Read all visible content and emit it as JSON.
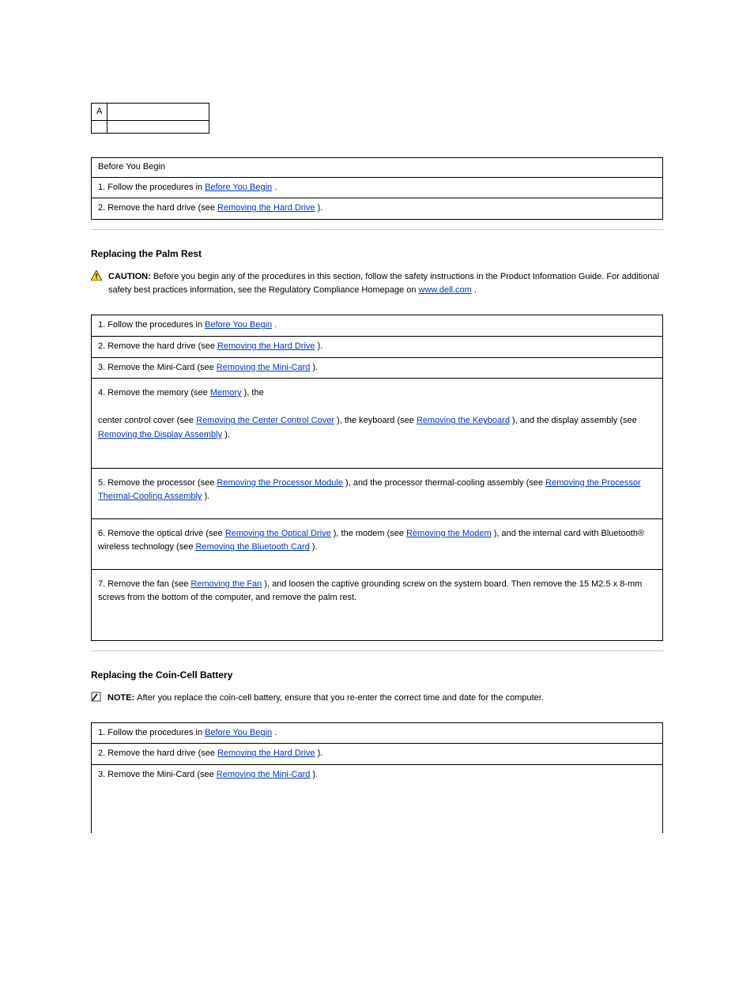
{
  "typeA": {
    "rows": [
      [
        "A",
        ""
      ],
      [
        "",
        ""
      ]
    ]
  },
  "before": {
    "header": "Before You Begin",
    "row1": {
      "prefix": "1. Follow the procedures in ",
      "link": "Before You Begin",
      "suffix": "."
    },
    "row2": {
      "prefix": "2. Remove the hard drive (see ",
      "link": "Removing the Hard Drive",
      "suffix": ")."
    }
  },
  "palm": {
    "heading": "Replacing the Palm Rest",
    "caution": {
      "bold": "CAUTION: ",
      "body": "Before you begin any of the procedures in this section, follow the safety instructions in the Product Information Guide. For additional safety best practices information, see the Regulatory Compliance Homepage on ",
      "linkText": "www.dell.com",
      "suffix": "."
    },
    "rows": {
      "r1": {
        "prefix": "1. Follow the procedures in ",
        "link": "Before You Begin",
        "suffix": "."
      },
      "r2": {
        "prefix": "2. Remove the hard drive (see ",
        "link": "Removing the Hard Drive",
        "suffix": ")."
      },
      "r3": {
        "prefix": "3. Remove the Mini-Card (see ",
        "link": "Removing the Mini-Card",
        "suffix": ")."
      },
      "r4": {
        "prefix": "4. Remove the memory (see ",
        "link1": "Memory",
        "mid": "), the ",
        "body2": "center control cover (see ",
        "link2": "Removing the Center Control Cover",
        "body3": "), the keyboard (see ",
        "link3": "Removing the Keyboard",
        "body4": "), and the display assembly (see ",
        "link4": "Removing the Display Assembly",
        "suffix": ")."
      },
      "r5": {
        "prefix": "5. Remove the processor (see ",
        "link1": "Removing the Processor Module",
        "body2": "), and the processor thermal-cooling assembly (see ",
        "link2": "Removing the Processor Thermal-Cooling Assembly",
        "suffix": ")."
      },
      "r6": {
        "prefix": "6. Remove the optical drive (see ",
        "link1": "Removing the Optical Drive",
        "body2": "), the modem (see ",
        "link2": "Removing the Modem",
        "body3": "), and the internal card with Bluetooth® wireless technology (see ",
        "link3": "Removing the Bluetooth Card",
        "suffix": ")."
      },
      "r7": {
        "prefix": "7. Remove the fan (see ",
        "link": "Removing the Fan",
        "body2": "), and loosen the captive grounding screw on the system board. Then remove the 15 M2.5 x 8-mm screws from the bottom of the computer, and remove the palm rest.",
        "suffix": ""
      }
    }
  },
  "coin": {
    "heading": "Replacing the Coin-Cell Battery",
    "note": {
      "bold": "NOTE: ",
      "body": "After you replace the coin-cell battery, ensure that you re-enter the correct time and date for the computer."
    },
    "rows": {
      "r1": {
        "prefix": "1. Follow the procedures in ",
        "link": "Before You Begin",
        "suffix": "."
      },
      "r2": {
        "prefix": "2. Remove the hard drive (see ",
        "link": "Removing the Hard Drive",
        "suffix": ")."
      },
      "r3": {
        "prefix": "3. Remove the Mini-Card (see ",
        "link": "Removing the Mini-Card",
        "suffix": ")."
      }
    }
  }
}
